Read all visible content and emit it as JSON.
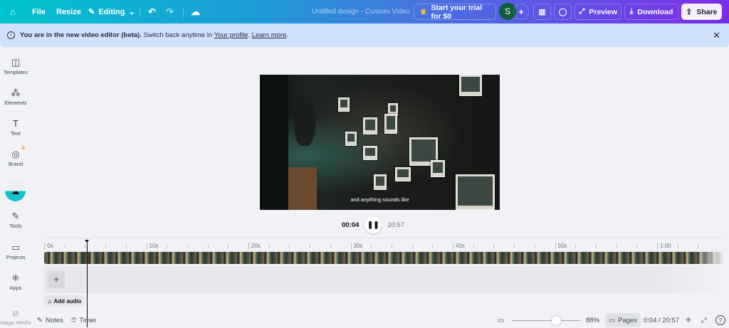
{
  "topbar": {
    "file": "File",
    "resize": "Resize",
    "editing": "Editing",
    "title": "Untitled design - Custom Video",
    "trial": "Start your trial for $0",
    "avatar": "S",
    "preview": "Preview",
    "download": "Download",
    "share": "Share"
  },
  "banner": {
    "bold": "You are in the new video editor (beta).",
    "text": " Switch back anytime in ",
    "link1": "Your profile",
    "dot": ". ",
    "link2": "Learn more",
    "end": "."
  },
  "sidebar": {
    "items": [
      {
        "label": "Templates",
        "icon": "templates-icon"
      },
      {
        "label": "Elements",
        "icon": "elements-icon"
      },
      {
        "label": "Text",
        "icon": "text-icon"
      },
      {
        "label": "Brand",
        "icon": "brand-icon"
      },
      {
        "label": "",
        "icon": "upload-icon"
      },
      {
        "label": "Tools",
        "icon": "tools-icon"
      },
      {
        "label": "Projects",
        "icon": "projects-icon"
      },
      {
        "label": "Apps",
        "icon": "apps-icon"
      },
      {
        "label": "Magic Media",
        "icon": "magic-media-icon"
      }
    ]
  },
  "video": {
    "caption": "and anything sounds like"
  },
  "player": {
    "current": "00:04",
    "total": "20:57"
  },
  "timeline": {
    "labels": [
      "0s",
      "10s",
      "20s",
      "30s",
      "40s",
      "50s",
      "1:00"
    ],
    "add_audio": "Add audio"
  },
  "footer": {
    "notes": "Notes",
    "timer": "Timer",
    "zoom": "88%",
    "zoom_value": 88,
    "pages": "Pages",
    "time": "0:04 / 20:57"
  },
  "colors": {
    "accent": "#00c4cc",
    "purple": "#7d2ae8",
    "avatar": "#0b5d3b"
  }
}
